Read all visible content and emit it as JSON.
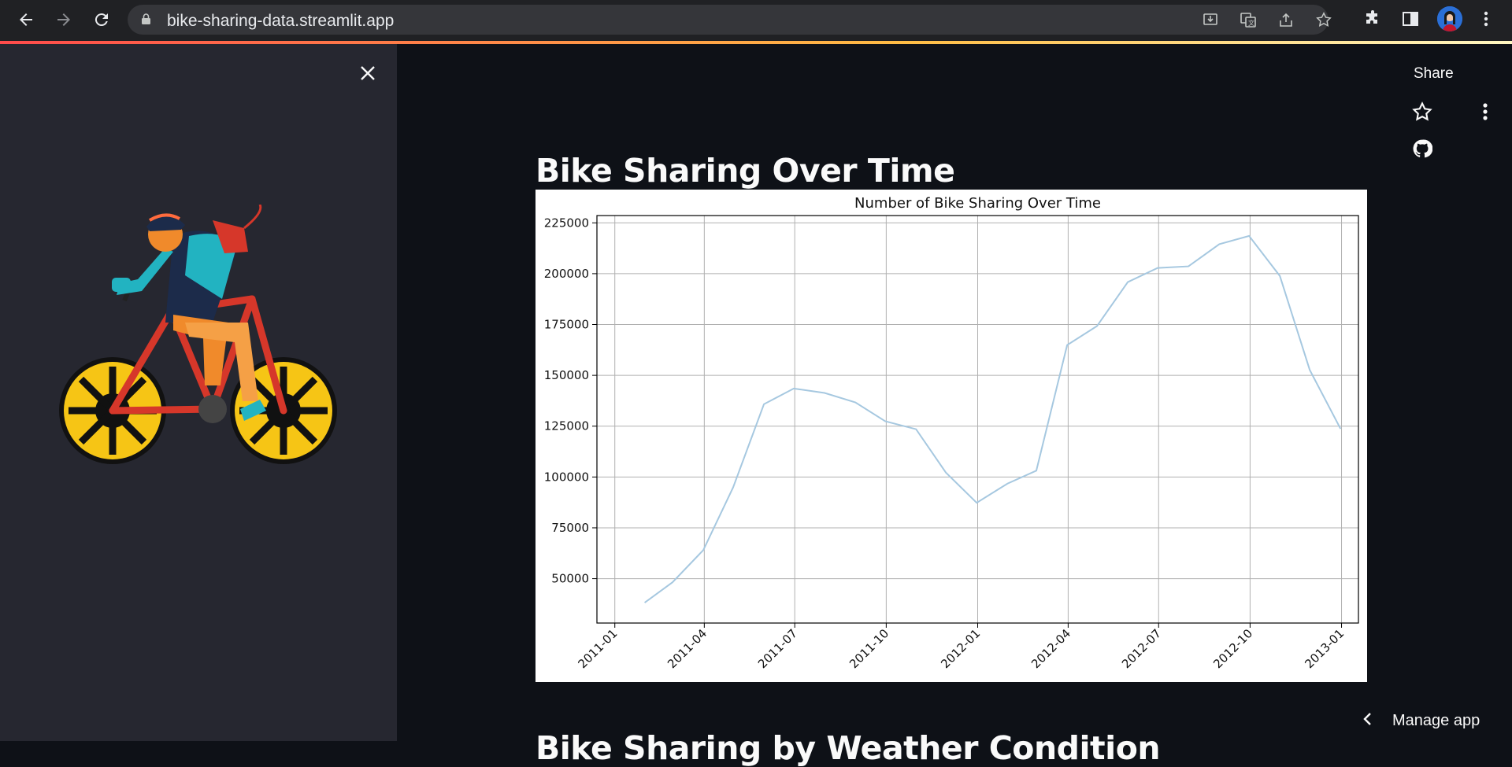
{
  "browser": {
    "url": "bike-sharing-data.streamlit.app",
    "nav_icons": [
      "back-arrow-icon",
      "forward-arrow-icon",
      "reload-icon"
    ],
    "omnibox_icons": [
      "install-icon",
      "translate-icon",
      "share-icon",
      "bookmark-star-icon"
    ],
    "toolbar_icons": [
      "extensions-icon",
      "side-panel-icon",
      "profile-avatar",
      "chrome-menu-icon"
    ]
  },
  "sidebar": {
    "close_icon": "close-icon",
    "image": "cyclist-illustration"
  },
  "header": {
    "share_label": "Share",
    "star_icon": "star-icon",
    "menu_icon": "more-vert-icon",
    "github_icon": "github-icon"
  },
  "main": {
    "title": "Bike Sharing Over Time",
    "next_title": "Bike Sharing by Weather Condition",
    "manage_label": "Manage app"
  },
  "colors": {
    "line": "#a6c8e0",
    "background_main": "#0e1117",
    "background_sidebar": "#262730"
  },
  "chart_data": {
    "type": "line",
    "title": "Number of Bike Sharing Over Time",
    "xlabel": "",
    "ylabel": "",
    "x": [
      "2011-01-31",
      "2011-02-28",
      "2011-03-31",
      "2011-04-30",
      "2011-05-31",
      "2011-06-30",
      "2011-07-31",
      "2011-08-31",
      "2011-09-30",
      "2011-10-31",
      "2011-11-30",
      "2011-12-31",
      "2012-01-31",
      "2012-02-29",
      "2012-03-31",
      "2012-04-30",
      "2012-05-31",
      "2012-06-30",
      "2012-07-31",
      "2012-08-31",
      "2012-09-30",
      "2012-10-31",
      "2012-11-30",
      "2012-12-31"
    ],
    "series": [
      {
        "values": [
          38189,
          48215,
          64045,
          94870,
          135821,
          143512,
          141341,
          136691,
          127418,
          123511,
          102167,
          87323,
          96744,
          103137,
          164875,
          174224,
          195865,
          202830,
          203607,
          214503,
          218573,
          198841,
          152664,
          123713
        ]
      }
    ],
    "xticks": [
      "2011-01",
      "2011-04",
      "2011-07",
      "2011-10",
      "2012-01",
      "2012-04",
      "2012-07",
      "2012-10",
      "2013-01"
    ],
    "yticks": [
      50000,
      75000,
      100000,
      125000,
      150000,
      175000,
      200000,
      225000
    ],
    "xlim": [
      "2010-12-14",
      "2013-01-18"
    ],
    "ylim": [
      28170,
      228592
    ],
    "grid": true
  }
}
